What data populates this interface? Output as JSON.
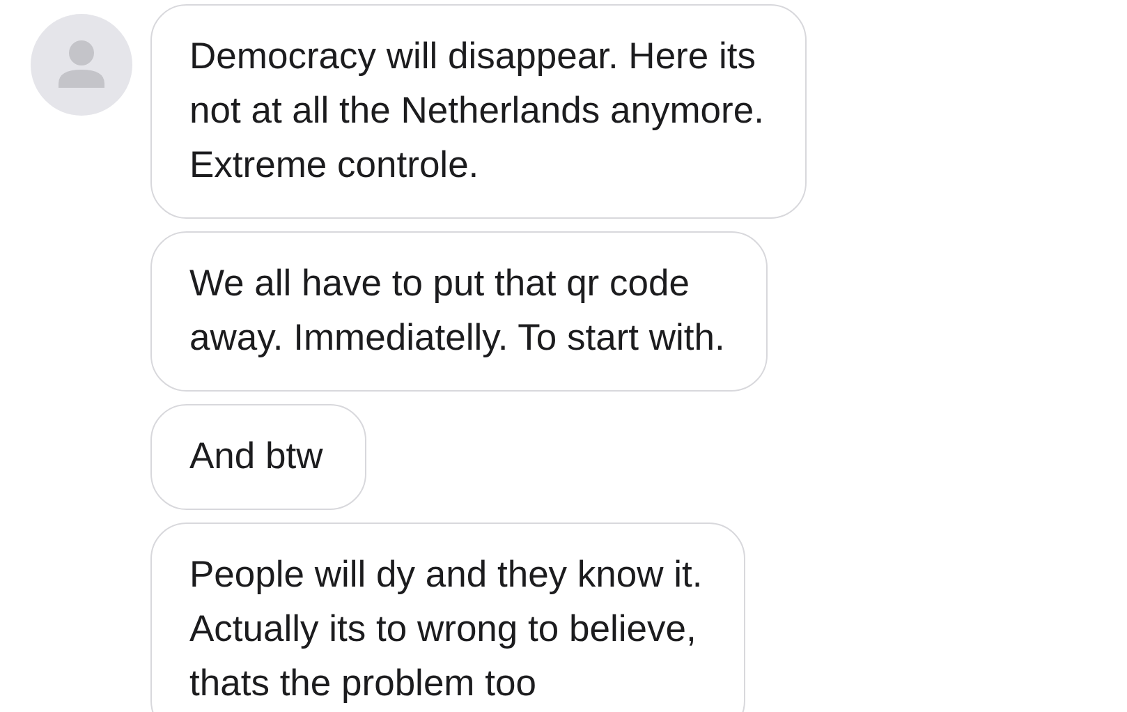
{
  "messages": [
    {
      "text": "Democracy will disappear. Here its\nnot at all the Netherlands anymore.\nExtreme controle."
    },
    {
      "text": "We all have to put that qr code\naway. Immediatelly. To start with."
    },
    {
      "text": "And btw"
    },
    {
      "text": "People will dy and they know it.\nActually its to wrong to believe,\nthats the problem too"
    }
  ]
}
